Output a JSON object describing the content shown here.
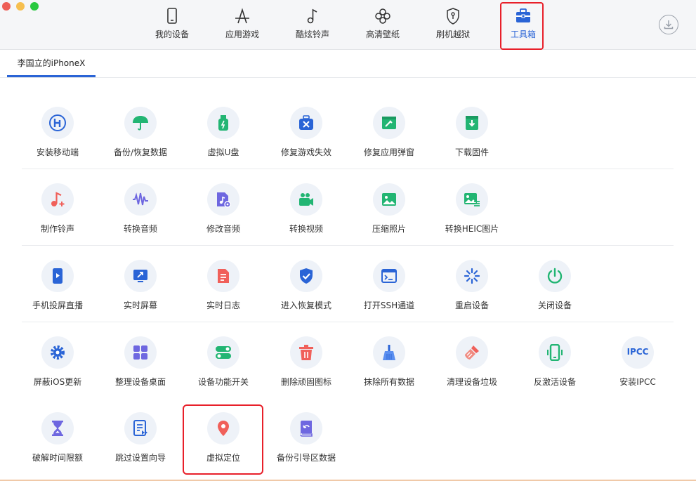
{
  "nav": {
    "items": [
      {
        "label": "我的设备",
        "icon": "phone-icon"
      },
      {
        "label": "应用游戏",
        "icon": "app-store-icon"
      },
      {
        "label": "酷炫铃声",
        "icon": "music-note-icon"
      },
      {
        "label": "高清壁纸",
        "icon": "flower-icon"
      },
      {
        "label": "刷机越狱",
        "icon": "shield-key-icon"
      },
      {
        "label": "工具箱",
        "icon": "toolbox-icon"
      }
    ],
    "active_index": 5,
    "accent": "#2a64d6"
  },
  "device_tab": {
    "label": "李国立的iPhoneX"
  },
  "tools": {
    "row1": [
      {
        "label": "安装移动端",
        "icon": "install-mobile-icon"
      },
      {
        "label": "备份/恢复数据",
        "icon": "umbrella-icon"
      },
      {
        "label": "虚拟U盘",
        "icon": "usb-drive-icon"
      },
      {
        "label": "修复游戏失效",
        "icon": "repair-toolbox-icon"
      },
      {
        "label": "修复应用弹窗",
        "icon": "repair-window-icon"
      },
      {
        "label": "下载固件",
        "icon": "download-firmware-icon"
      }
    ],
    "row2": [
      {
        "label": "制作铃声",
        "icon": "ringtone-icon"
      },
      {
        "label": "转换音频",
        "icon": "waveform-icon"
      },
      {
        "label": "修改音频",
        "icon": "audio-file-icon"
      },
      {
        "label": "转换视频",
        "icon": "video-camera-icon"
      },
      {
        "label": "压缩照片",
        "icon": "photo-icon"
      },
      {
        "label": "转换HEIC图片",
        "icon": "heic-image-icon"
      }
    ],
    "row3": [
      {
        "label": "手机投屏直播",
        "icon": "phone-screen-icon"
      },
      {
        "label": "实时屏幕",
        "icon": "screen-share-icon"
      },
      {
        "label": "实时日志",
        "icon": "log-document-icon"
      },
      {
        "label": "进入恢复模式",
        "icon": "shield-check-icon"
      },
      {
        "label": "打开SSH通道",
        "icon": "terminal-icon"
      },
      {
        "label": "重启设备",
        "icon": "loading-spinner-icon"
      },
      {
        "label": "关闭设备",
        "icon": "power-icon"
      }
    ],
    "row4": [
      {
        "label": "屏蔽iOS更新",
        "icon": "gear-icon"
      },
      {
        "label": "整理设备桌面",
        "icon": "grid-apps-icon"
      },
      {
        "label": "设备功能开关",
        "icon": "toggle-switch-icon"
      },
      {
        "label": "删除顽固图标",
        "icon": "trash-icon"
      },
      {
        "label": "抹除所有数据",
        "icon": "broom-icon"
      },
      {
        "label": "清理设备垃圾",
        "icon": "cleaning-brush-icon"
      },
      {
        "label": "反激活设备",
        "icon": "phone-vibrate-icon"
      },
      {
        "label": "安装IPCC",
        "icon": "ipcc-text-icon",
        "icon_text": "IPCC"
      }
    ],
    "row5": [
      {
        "label": "破解时间限额",
        "icon": "hourglass-icon"
      },
      {
        "label": "跳过设置向导",
        "icon": "skip-settings-icon"
      },
      {
        "label": "虚拟定位",
        "icon": "location-pin-icon"
      },
      {
        "label": "备份引导区数据",
        "icon": "backup-boot-icon"
      }
    ]
  },
  "colors": {
    "highlight": "#e8202a",
    "icon_blue": "#2a64d6",
    "icon_green": "#22b573",
    "icon_red": "#f0605a",
    "icon_purple": "#6e67e0"
  }
}
